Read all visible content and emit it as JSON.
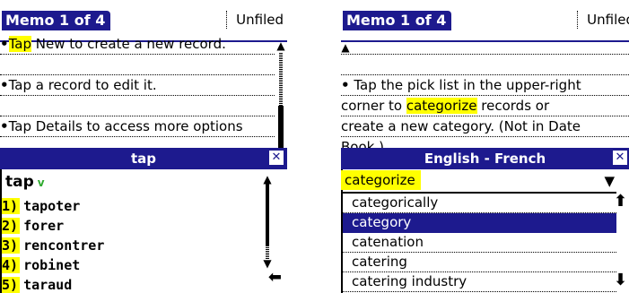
{
  "left": {
    "title": "Memo 1 of 4",
    "category": "Unfiled",
    "memo_lines": [
      {
        "highlight": "Tap",
        "rest": " New to create a new record."
      },
      {
        "highlight": "",
        "rest": ""
      },
      {
        "highlight": "",
        "rest": "Tap a record to edit it."
      },
      {
        "highlight": "",
        "rest": ""
      },
      {
        "highlight": "",
        "rest": "Tap Details to access more options"
      }
    ],
    "popup": {
      "header": "tap",
      "close": "✕",
      "headword": "tap",
      "pos": "v",
      "senses": [
        {
          "num": "1)",
          "word": "tapoter"
        },
        {
          "num": "2)",
          "word": "forer"
        },
        {
          "num": "3)",
          "word": "rencontrer"
        },
        {
          "num": "4)",
          "word": "robinet"
        },
        {
          "num": "5)",
          "word": "taraud"
        }
      ],
      "back_arrow": "⬅"
    }
  },
  "right": {
    "title": "Memo 1 of 4",
    "category": "Unfiled",
    "memo_lines": [
      {
        "before": "",
        "highlight": "",
        "after": ""
      },
      {
        "before": "",
        "highlight": "",
        "after": ""
      },
      {
        "before": "Tap the pick list in the upper-right",
        "highlight": "",
        "after": ""
      },
      {
        "before": "corner to ",
        "highlight": "categorize",
        "after": " records or"
      },
      {
        "before": "create a new category. (Not in Date",
        "highlight": "",
        "after": ""
      },
      {
        "before": "Book.)",
        "highlight": "",
        "after": ""
      }
    ],
    "popup": {
      "header": "English - French",
      "close": "✕",
      "search_value": "categorize",
      "dropdown": "▼",
      "words": [
        "categorically",
        "category",
        "catenation",
        "catering",
        "catering industry"
      ],
      "selected_index": 1,
      "up_arrow": "⬆",
      "down_arrow": "⬇"
    }
  },
  "colors": {
    "title_bar": "#1d1a8e",
    "highlight": "#ffff00",
    "pos_green": "#2faa2f"
  }
}
